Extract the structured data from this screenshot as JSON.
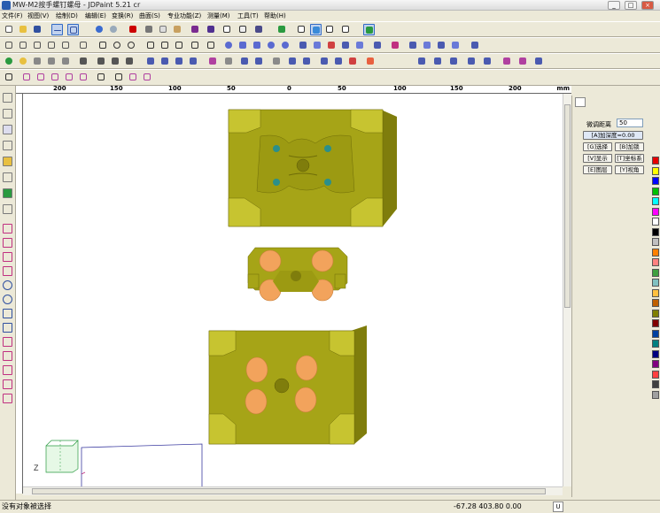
{
  "title": "MW-M2按手螺钉螺母 - JDPaint 5.21 cr",
  "window_controls": [
    "_",
    "□",
    "×"
  ],
  "menu": [
    "文件(F)",
    "视图(V)",
    "绘制(D)",
    "编辑(E)",
    "变换(R)",
    "曲面(S)",
    "专业功能(Z)",
    "测量(M)",
    "工具(T)",
    "帮助(H)"
  ],
  "ruler": {
    "labels": [
      "200",
      "150",
      "100",
      "50",
      "0",
      "50",
      "100",
      "150",
      "200"
    ],
    "unit": "mm"
  },
  "panel": {
    "spacing_label": "微调距离",
    "spacing_value": "50",
    "depth_button": "[A]加深度=0.00",
    "buttons": [
      "[G]选择",
      "[B]加锁",
      "[V]显示",
      "[T]坐标系",
      "[E]图层",
      "[Y]视角"
    ]
  },
  "status": {
    "message": "没有对象被选择",
    "coords": "-67.28 403.80 0.00",
    "unit_button": "U"
  },
  "palette": [
    "#e60000",
    "#ffff00",
    "#0000ff",
    "#00c000",
    "#00ffff",
    "#ff00ff",
    "#ffffff",
    "#000000",
    "#c0c0c0",
    "#ff8000",
    "#ff8080",
    "#40a040",
    "#80c0c0",
    "#ffc040",
    "#c06000",
    "#808000",
    "#800000",
    "#0040a0",
    "#008080",
    "#000080",
    "#800080",
    "#ff4040",
    "#404040",
    "#a0a0a0"
  ],
  "colors": {
    "mold": "#a6a417",
    "mold_light": "#c7c430",
    "mold_dark": "#7f7d0c",
    "part": "#f2a35c",
    "hole": "#2b8f8a"
  },
  "icons": {
    "left_tools": [
      "select-icon",
      "zoom-icon",
      "text-icon",
      "pen-icon",
      "eraser-icon",
      "rotate-icon",
      "line-icon",
      "arc-icon",
      "circle-icon",
      "rect-icon",
      "polygon-icon",
      "spline-icon",
      "trim-icon",
      "offset-icon"
    ]
  }
}
